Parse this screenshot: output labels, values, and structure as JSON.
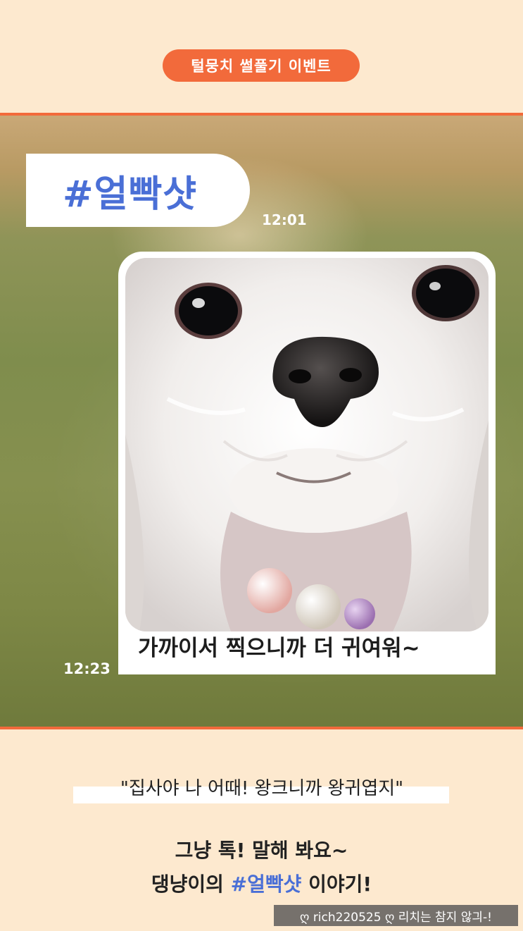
{
  "header": {
    "event_label": "털뭉치 썰풀기 이벤트"
  },
  "story": {
    "hashtag": "#얼빡샷",
    "timestamp_top": "12:01",
    "timestamp_bottom": "12:23",
    "caption": "가까이서 찍으니까 더 귀여워~"
  },
  "footer": {
    "quote": "\"집사야 나 어때! 왕크니까 왕귀엽지\"",
    "cta_line1": "그냥 톡! 말해 봐요~",
    "cta_line2_prefix": "댕냥이의 ",
    "cta_line2_hashtag": "#얼빡샷",
    "cta_line2_suffix": " 이야기!",
    "watermark": "ღ rich220525 ღ 리치는 참지 않긔-!"
  },
  "colors": {
    "accent_orange": "#f26a3b",
    "accent_blue": "#4a6fd6",
    "background_cream": "#fde9cf"
  },
  "icons": {
    "dog_photo": "maltese-closeup-photo"
  }
}
